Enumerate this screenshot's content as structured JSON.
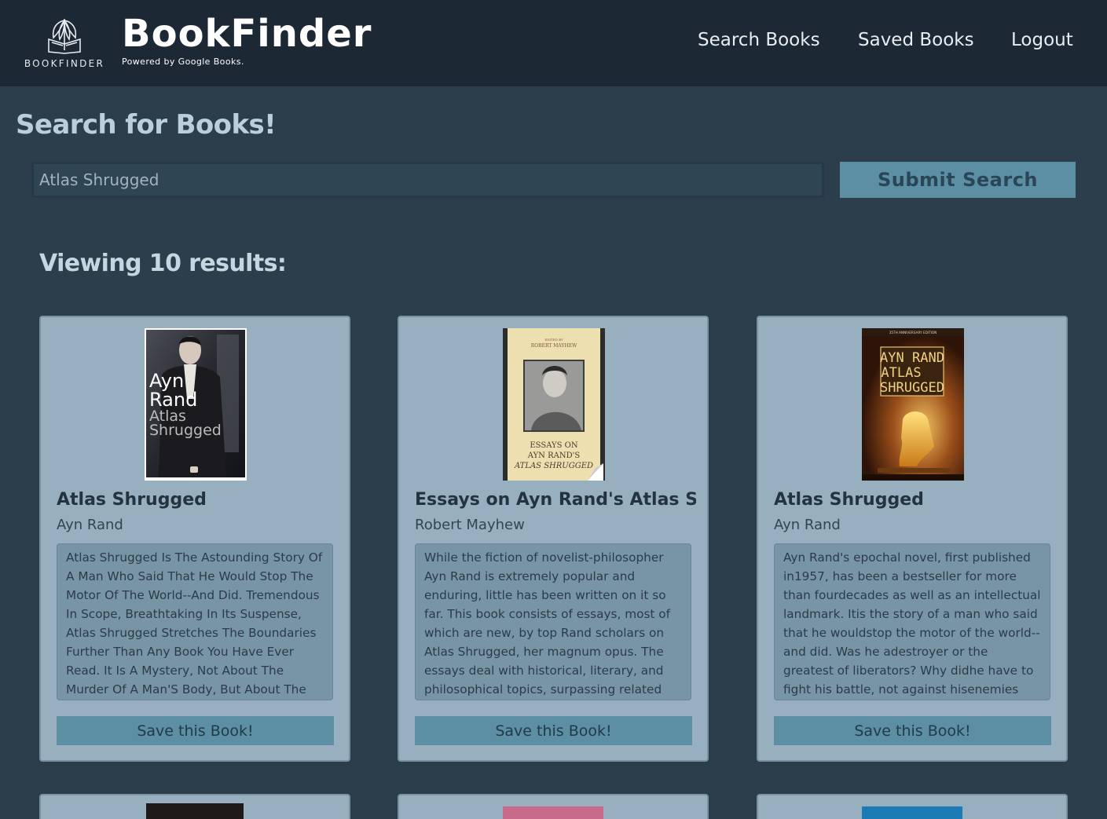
{
  "navbar": {
    "logo_word": "BOOKFINDER",
    "brand": "BookFinder",
    "tagline": "Powered by Google Books.",
    "links": [
      "Search Books",
      "Saved Books",
      "Logout"
    ]
  },
  "search": {
    "heading": "Search for Books!",
    "value": "Atlas Shrugged",
    "submit_label": "Submit Search"
  },
  "results": {
    "heading": "Viewing 10 results:",
    "books": [
      {
        "title": "Atlas Shrugged",
        "author": "Ayn Rand",
        "description": "Atlas Shrugged Is The Astounding Story Of A Man Who Said That He Would Stop The Motor Of The World--And Did. Tremendous In Scope, Breathtaking In Its Suspense, Atlas Shrugged Stretches The Boundaries Further Than Any Book You Have Ever Read. It Is A Mystery, Not About The Murder Of A Man'S Body, But About The Murder--And Rebirth--",
        "save_label": "Save this Book!",
        "cover_text": [
          "Ayn",
          "Rand",
          "Atlas",
          "Shrugged"
        ]
      },
      {
        "title": "Essays on Ayn Rand's Atlas Shrugged",
        "author": "Robert Mayhew",
        "description": "While the fiction of novelist-philosopher Ayn Rand is extremely popular and enduring, little has been written on it so far. This book consists of essays, most of which are new, by top Rand scholars on Atlas Shrugged, her magnum opus. The essays deal with historical, literary, and philosophical topics, surpassing related writings in breadth and",
        "save_label": "Save this Book!",
        "cover_text": [
          "EDITED BY",
          "ROBERT MAYHEW",
          "ESSAYS ON",
          "AYN RAND'S",
          "ATLAS SHRUGGED"
        ]
      },
      {
        "title": "Atlas Shrugged",
        "author": "Ayn Rand",
        "description": "Ayn Rand's epochal novel, first published in1957, has been a bestseller for more than fourdecades as well as an intellectual landmark. Itis the story of a man who said that he wouldstop the motor of the world--and did. Was he adestroyer or the greatest of liberators? Why didhe have to fight his battle, not against hisenemies but against",
        "save_label": "Save this Book!",
        "cover_text": [
          "35TH ANNIVERSARY EDITION",
          "AYN RAND",
          "ATLAS",
          "SHRUGGED"
        ]
      }
    ]
  }
}
